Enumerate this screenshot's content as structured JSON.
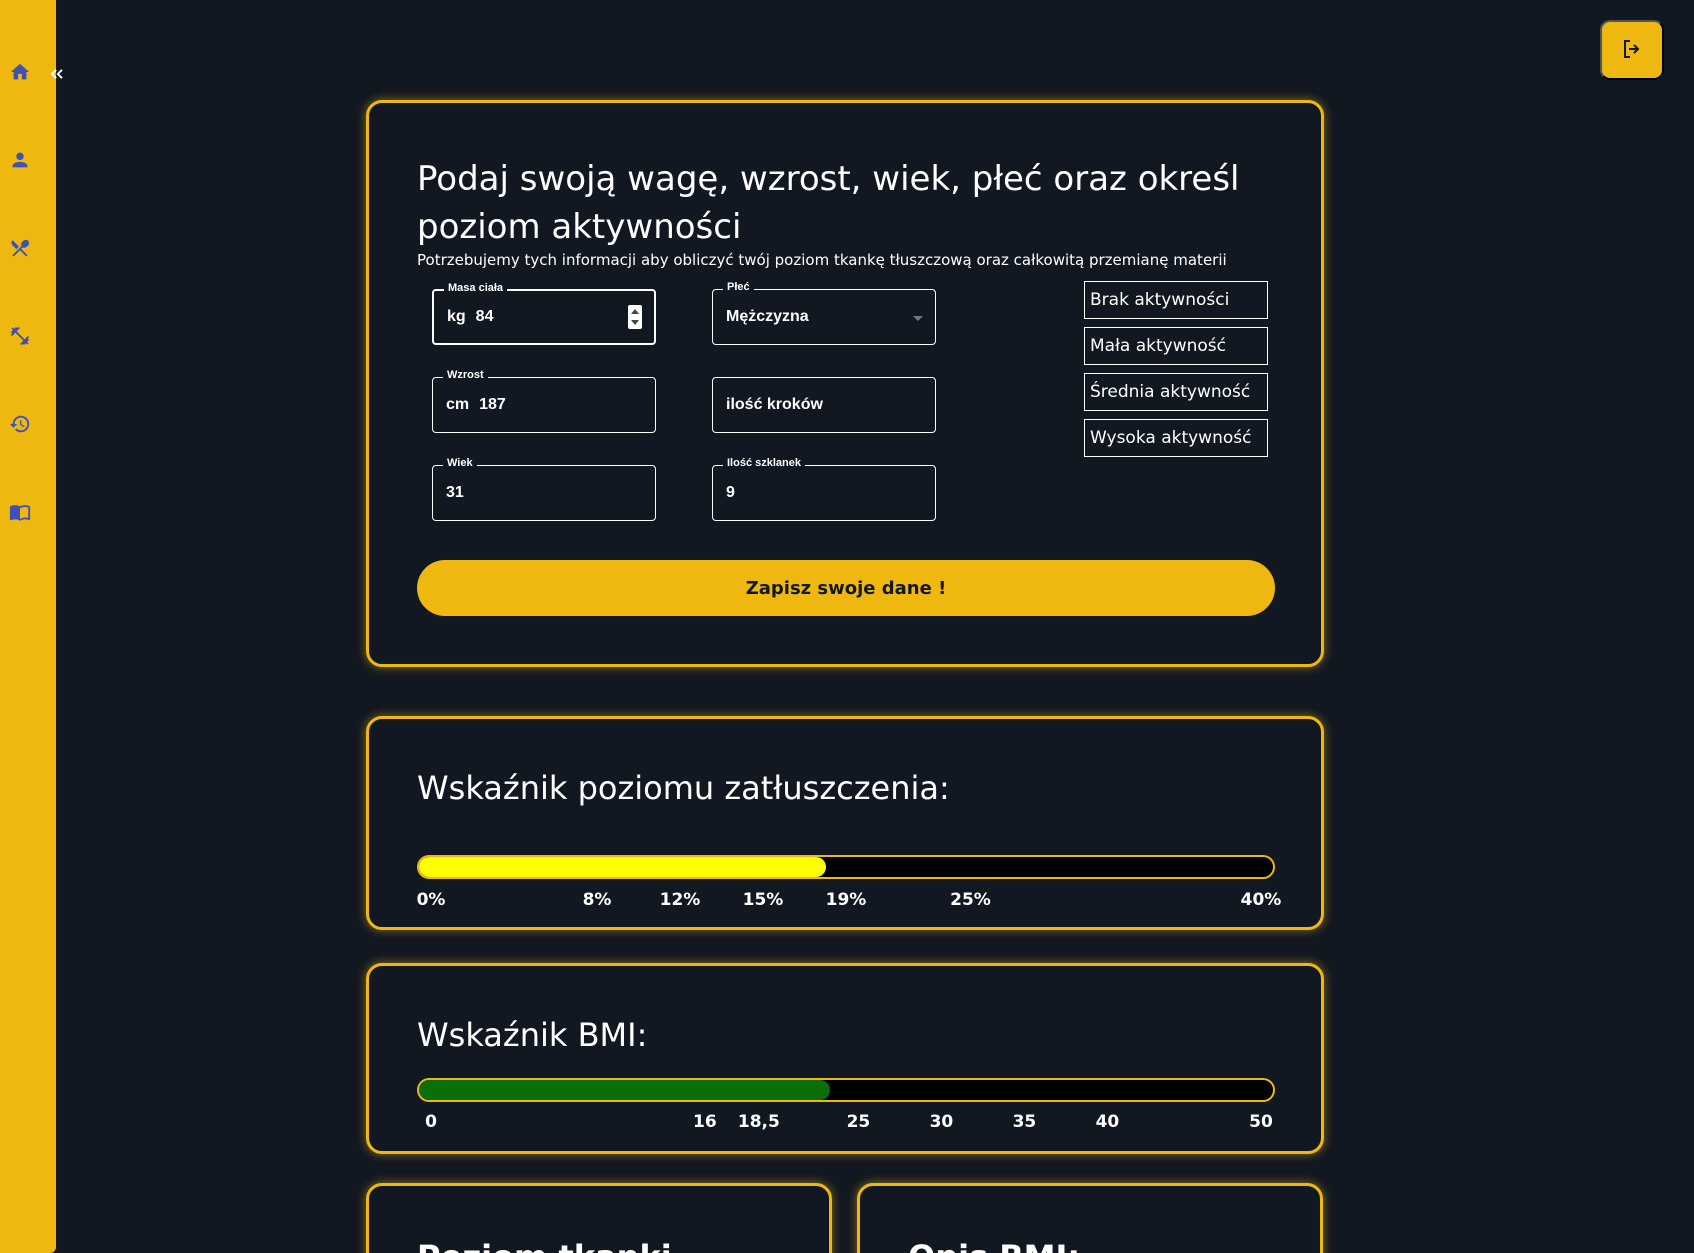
{
  "sidebar": {
    "items": [
      {
        "icon": "home-icon"
      },
      {
        "icon": "person-icon"
      },
      {
        "icon": "utensils-icon"
      },
      {
        "icon": "dumbbell-icon"
      },
      {
        "icon": "history-icon"
      },
      {
        "icon": "book-icon"
      }
    ],
    "collapse_icon": "chevrons-left-icon"
  },
  "header": {
    "logout_icon": "logout-icon"
  },
  "form": {
    "title": "Podaj swoją wagę, wzrost, wiek, płeć oraz określ poziom aktywności",
    "subtitle": "Potrzebujemy tych informacji aby obliczyć twój poziom tkankę tłuszczową oraz całkowitą przemianę materii",
    "weight": {
      "label": "Masa ciała",
      "unit": "kg",
      "value": "84"
    },
    "gender": {
      "label": "Płeć",
      "value": "Mężczyzna"
    },
    "height": {
      "label": "Wzrost",
      "unit": "cm",
      "value": "187"
    },
    "steps": {
      "placeholder": "ilość kroków"
    },
    "age": {
      "label": "Wiek",
      "value": "31"
    },
    "glasses": {
      "label": "Ilość szklanek",
      "value": "9"
    },
    "activities": [
      "Brak aktywności",
      "Mała aktywność",
      "Średnia aktywność",
      "Wysoka aktywność"
    ],
    "save_label": "Zapisz swoje dane !"
  },
  "fat": {
    "title": "Wskaźnik poziomu zatłuszczenia:",
    "fill_fraction": 0.476,
    "fill_color": "#ffff00",
    "ticks": [
      {
        "label": "0%",
        "pos": 0
      },
      {
        "label": "8%",
        "pos": 0.2
      },
      {
        "label": "12%",
        "pos": 0.3
      },
      {
        "label": "15%",
        "pos": 0.4
      },
      {
        "label": "19%",
        "pos": 0.5
      },
      {
        "label": "25%",
        "pos": 0.65
      },
      {
        "label": "40%",
        "pos": 1
      }
    ]
  },
  "bmi": {
    "title": "Wskaźnik BMI:",
    "fill_fraction": 0.481,
    "fill_color": "#0a6e0a",
    "ticks": [
      {
        "label": "0",
        "pos": 0
      },
      {
        "label": "16",
        "pos": 0.33
      },
      {
        "label": "18,5",
        "pos": 0.395
      },
      {
        "label": "25",
        "pos": 0.515
      },
      {
        "label": "30",
        "pos": 0.615
      },
      {
        "label": "35",
        "pos": 0.715
      },
      {
        "label": "40",
        "pos": 0.815
      },
      {
        "label": "50",
        "pos": 1
      }
    ]
  },
  "cards_bottom": {
    "left_title": "Poziom tkanki",
    "right_title": "Opis BMI:"
  },
  "colors": {
    "accent": "#efb810",
    "background": "#121821",
    "icon": "#3f51b5"
  }
}
